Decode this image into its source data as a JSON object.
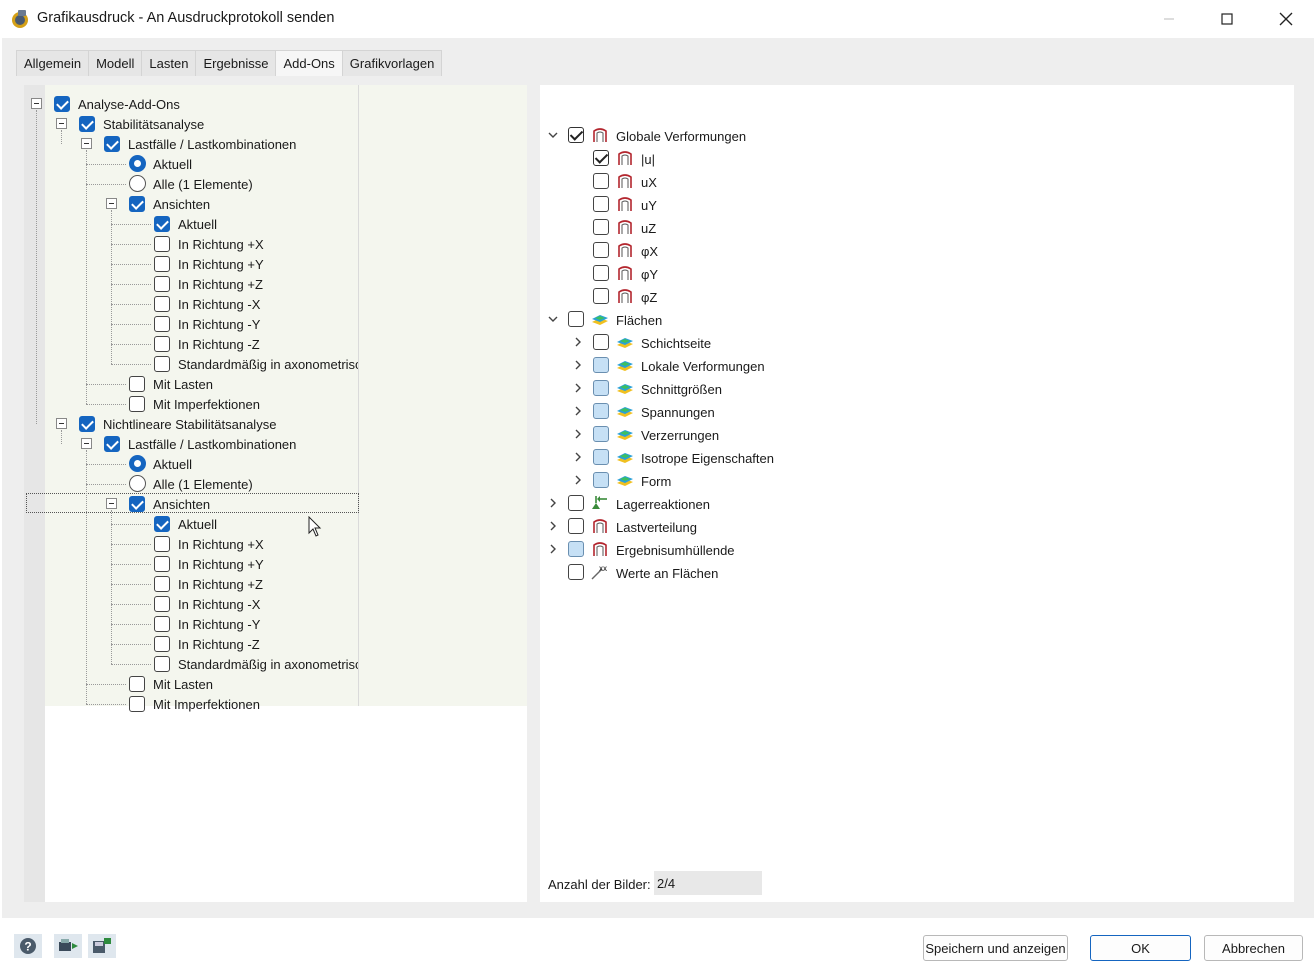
{
  "window": {
    "title": "Grafikausdruck - An Ausdruckprotokoll senden",
    "minimize_icon": "minimize-icon",
    "maximize_icon": "maximize-icon",
    "close_icon": "close-icon"
  },
  "tabs": [
    {
      "label": "Allgemein",
      "active": false
    },
    {
      "label": "Modell",
      "active": false
    },
    {
      "label": "Lasten",
      "active": false
    },
    {
      "label": "Ergebnisse",
      "active": false
    },
    {
      "label": "Add-Ons",
      "active": true
    },
    {
      "label": "Grafikvorlagen",
      "active": false
    }
  ],
  "left_tree": [
    {
      "label": "Analyse-Add-Ons",
      "level": 0,
      "control": "checkbox",
      "checked": true,
      "expander": true
    },
    {
      "label": "Stabilitätsanalyse",
      "level": 1,
      "control": "checkbox",
      "checked": true,
      "expander": true
    },
    {
      "label": "Lastfälle / Lastkombinationen",
      "level": 2,
      "control": "checkbox",
      "checked": true,
      "expander": true
    },
    {
      "label": "Aktuell",
      "level": 3,
      "control": "radio",
      "checked": true
    },
    {
      "label": "Alle (1 Elemente)",
      "level": 3,
      "control": "radio",
      "checked": false
    },
    {
      "label": "Ansichten",
      "level": 3,
      "control": "checkbox",
      "checked": true,
      "expander": true
    },
    {
      "label": "Aktuell",
      "level": 4,
      "control": "checkbox",
      "checked": true
    },
    {
      "label": "In Richtung +X",
      "level": 4,
      "control": "checkbox",
      "checked": false
    },
    {
      "label": "In Richtung +Y",
      "level": 4,
      "control": "checkbox",
      "checked": false
    },
    {
      "label": "In Richtung +Z",
      "level": 4,
      "control": "checkbox",
      "checked": false
    },
    {
      "label": "In Richtung -X",
      "level": 4,
      "control": "checkbox",
      "checked": false
    },
    {
      "label": "In Richtung -Y",
      "level": 4,
      "control": "checkbox",
      "checked": false
    },
    {
      "label": "In Richtung -Z",
      "level": 4,
      "control": "checkbox",
      "checked": false
    },
    {
      "label": "Standardmäßig in axonometrisc",
      "level": 4,
      "control": "checkbox",
      "checked": false
    },
    {
      "label": "Mit Lasten",
      "level": 3,
      "control": "checkbox",
      "checked": false
    },
    {
      "label": "Mit Imperfektionen",
      "level": 3,
      "control": "checkbox",
      "checked": false
    },
    {
      "label": "Nichtlineare Stabilitätsanalyse",
      "level": 1,
      "control": "checkbox",
      "checked": true,
      "expander": true
    },
    {
      "label": "Lastfälle / Lastkombinationen",
      "level": 2,
      "control": "checkbox",
      "checked": true,
      "expander": true
    },
    {
      "label": "Aktuell",
      "level": 3,
      "control": "radio",
      "checked": true
    },
    {
      "label": "Alle (1 Elemente)",
      "level": 3,
      "control": "radio",
      "checked": false
    },
    {
      "label": "Ansichten",
      "level": 3,
      "control": "checkbox",
      "checked": true,
      "expander": true,
      "focused": true
    },
    {
      "label": "Aktuell",
      "level": 4,
      "control": "checkbox",
      "checked": true
    },
    {
      "label": "In Richtung +X",
      "level": 4,
      "control": "checkbox",
      "checked": false
    },
    {
      "label": "In Richtung +Y",
      "level": 4,
      "control": "checkbox",
      "checked": false
    },
    {
      "label": "In Richtung +Z",
      "level": 4,
      "control": "checkbox",
      "checked": false
    },
    {
      "label": "In Richtung -X",
      "level": 4,
      "control": "checkbox",
      "checked": false
    },
    {
      "label": "In Richtung -Y",
      "level": 4,
      "control": "checkbox",
      "checked": false
    },
    {
      "label": "In Richtung -Z",
      "level": 4,
      "control": "checkbox",
      "checked": false
    },
    {
      "label": "Standardmäßig in axonometrisc",
      "level": 4,
      "control": "checkbox",
      "checked": false
    },
    {
      "label": "Mit Lasten",
      "level": 3,
      "control": "checkbox",
      "checked": false
    },
    {
      "label": "Mit Imperfektionen",
      "level": 3,
      "control": "checkbox",
      "checked": false
    }
  ],
  "right_tree": [
    {
      "label": "Globale Verformungen",
      "level": 0,
      "state": "checked",
      "chevron": "down",
      "icon": "deformation-icon"
    },
    {
      "label": "|u|",
      "level": 1,
      "state": "checked",
      "chevron": "none",
      "icon": "deformation-icon"
    },
    {
      "label": "uX",
      "level": 1,
      "state": "unchecked",
      "chevron": "none",
      "icon": "deformation-icon"
    },
    {
      "label": "uY",
      "level": 1,
      "state": "unchecked",
      "chevron": "none",
      "icon": "deformation-icon"
    },
    {
      "label": "uZ",
      "level": 1,
      "state": "unchecked",
      "chevron": "none",
      "icon": "deformation-icon"
    },
    {
      "label": "φX",
      "level": 1,
      "state": "unchecked",
      "chevron": "none",
      "icon": "deformation-icon"
    },
    {
      "label": "φY",
      "level": 1,
      "state": "unchecked",
      "chevron": "none",
      "icon": "deformation-icon"
    },
    {
      "label": "φZ",
      "level": 1,
      "state": "unchecked",
      "chevron": "none",
      "icon": "deformation-icon"
    },
    {
      "label": "Flächen",
      "level": 0,
      "state": "unchecked",
      "chevron": "down",
      "icon": "surface-icon"
    },
    {
      "label": "Schichtseite",
      "level": 1,
      "state": "unchecked",
      "chevron": "right",
      "icon": "surface-icon"
    },
    {
      "label": "Lokale Verformungen",
      "level": 1,
      "state": "partial",
      "chevron": "right",
      "icon": "surface-icon"
    },
    {
      "label": "Schnittgrößen",
      "level": 1,
      "state": "partial",
      "chevron": "right",
      "icon": "surface-icon"
    },
    {
      "label": "Spannungen",
      "level": 1,
      "state": "partial",
      "chevron": "right",
      "icon": "surface-icon"
    },
    {
      "label": "Verzerrungen",
      "level": 1,
      "state": "partial",
      "chevron": "right",
      "icon": "surface-icon"
    },
    {
      "label": "Isotrope Eigenschaften",
      "level": 1,
      "state": "partial",
      "chevron": "right",
      "icon": "surface-icon"
    },
    {
      "label": "Form",
      "level": 1,
      "state": "partial",
      "chevron": "right",
      "icon": "surface-icon"
    },
    {
      "label": "Lagerreaktionen",
      "level": 0,
      "state": "unchecked",
      "chevron": "right",
      "icon": "support-reaction-icon"
    },
    {
      "label": "Lastverteilung",
      "level": 0,
      "state": "unchecked",
      "chevron": "right",
      "icon": "deformation-icon"
    },
    {
      "label": "Ergebnisumhüllende",
      "level": 0,
      "state": "partial",
      "chevron": "right",
      "icon": "deformation-icon"
    },
    {
      "label": "Werte an Flächen",
      "level": 0,
      "state": "unchecked",
      "chevron": "none",
      "icon": "values-on-surfaces-icon"
    }
  ],
  "count": {
    "label": "Anzahl der Bilder:",
    "value": "2/4"
  },
  "footer": {
    "tools": [
      "help-icon",
      "print-queue-icon",
      "save-settings-icon"
    ],
    "save_show_label": "Speichern und anzeigen",
    "ok_label": "OK",
    "cancel_label": "Abbrechen"
  },
  "colors": {
    "accent": "#1565c0",
    "tree_bg": "#f4f6ee",
    "partial_fill": "#c6e0f5",
    "deformation_icon": "#b3262e"
  }
}
